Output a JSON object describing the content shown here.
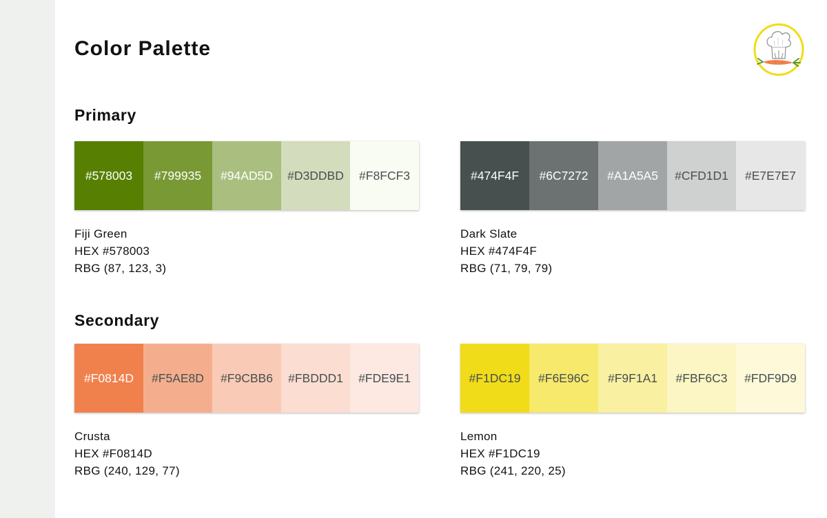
{
  "page": {
    "title": "Color Palette"
  },
  "sections": [
    {
      "title": "Primary",
      "palettes": [
        {
          "name": "Fiji Green",
          "hex_line": "HEX #578003",
          "rgb_line": "RBG (87, 123, 3)",
          "swatches": [
            {
              "label": "#578003",
              "color": "#578003",
              "text_color": "#ffffff"
            },
            {
              "label": "#799935",
              "color": "#799935",
              "text_color": "#ffffff"
            },
            {
              "label": "#94AD5D",
              "color": "#aabf7f",
              "text_color": "#ffffff"
            },
            {
              "label": "#D3DDBD",
              "color": "#d3ddbd",
              "text_color": "#474f4f"
            },
            {
              "label": "#F8FCF3",
              "color": "#f8fcf3",
              "text_color": "#474f4f"
            }
          ]
        },
        {
          "name": "Dark Slate",
          "hex_line": "HEX #474F4F",
          "rgb_line": "RBG (71, 79, 79)",
          "swatches": [
            {
              "label": "#474F4F",
              "color": "#474f4f",
              "text_color": "#ffffff"
            },
            {
              "label": "#6C7272",
              "color": "#6c7272",
              "text_color": "#ffffff"
            },
            {
              "label": "#A1A5A5",
              "color": "#a1a5a5",
              "text_color": "#ffffff"
            },
            {
              "label": "#CFD1D1",
              "color": "#cfd1d1",
              "text_color": "#474f4f"
            },
            {
              "label": "#E7E7E7",
              "color": "#e7e7e7",
              "text_color": "#474f4f"
            }
          ]
        }
      ]
    },
    {
      "title": "Secondary",
      "palettes": [
        {
          "name": "Crusta",
          "hex_line": "HEX #F0814D",
          "rgb_line": "RBG (240, 129, 77)",
          "swatches": [
            {
              "label": "#F0814D",
              "color": "#f0814d",
              "text_color": "#ffffff"
            },
            {
              "label": "#F5AE8D",
              "color": "#f5ae8d",
              "text_color": "#474f4f"
            },
            {
              "label": "#F9CBB6",
              "color": "#f9cbb6",
              "text_color": "#474f4f"
            },
            {
              "label": "#FBDDD1",
              "color": "#fbddd1",
              "text_color": "#474f4f"
            },
            {
              "label": "#FDE9E1",
              "color": "#fde9e1",
              "text_color": "#474f4f"
            }
          ]
        },
        {
          "name": "Lemon",
          "hex_line": "HEX #F1DC19",
          "rgb_line": "RBG (241, 220, 25)",
          "swatches": [
            {
              "label": "#F1DC19",
              "color": "#f1dc19",
              "text_color": "#474f4f"
            },
            {
              "label": "#F6E96C",
              "color": "#f6e96c",
              "text_color": "#474f4f"
            },
            {
              "label": "#F9F1A1",
              "color": "#f9f1a1",
              "text_color": "#474f4f"
            },
            {
              "label": "#FBF6C3",
              "color": "#fbf6c3",
              "text_color": "#474f4f"
            },
            {
              "label": "#FDF9D9",
              "color": "#fdf9d9",
              "text_color": "#474f4f"
            }
          ]
        }
      ]
    }
  ],
  "logo": {
    "icon": "chef-hat-carrot-icon",
    "ring_color": "#f1dc19"
  }
}
